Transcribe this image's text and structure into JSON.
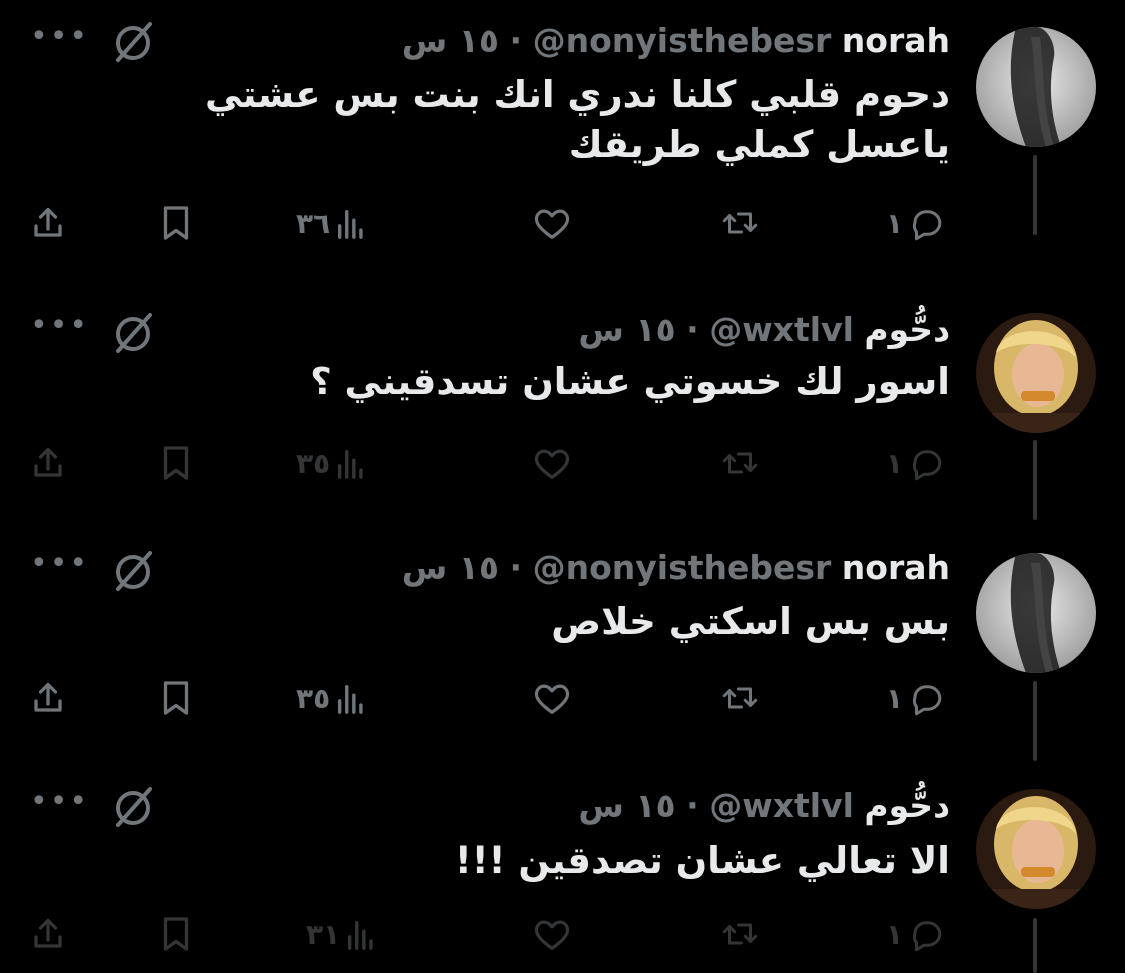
{
  "tweets": [
    {
      "name": "norah",
      "handle": "@nonyisthebesr",
      "dot": "·",
      "time": "١٥ س",
      "text": "دحوم قلبي كلنا ندري انك بنت بس عشتي ياعسل كملي طريقك",
      "replies": "١",
      "views": "٣٦",
      "avatar": "dark-hair"
    },
    {
      "name": "دحُّوم",
      "handle": "@wxtlvl",
      "dot": "·",
      "time": "١٥ س",
      "text": "اسور لك خسوتي عشان تسدقيني ؟",
      "replies": "١",
      "views": "٣٥",
      "avatar": "blonde"
    },
    {
      "name": "norah",
      "handle": "@nonyisthebesr",
      "dot": "·",
      "time": "١٥ س",
      "text": "بس بس اسكتي خلاص",
      "replies": "١",
      "views": "٣٥",
      "avatar": "dark-hair"
    },
    {
      "name": "دحُّوم",
      "handle": "@wxtlvl",
      "dot": "·",
      "time": "١٥ س",
      "text": "الا تعالي عشان تصدقين !!!",
      "replies": "١",
      "views": "٣١",
      "avatar": "blonde"
    }
  ],
  "icons": {
    "more": "more-icon",
    "grok": "grok-icon",
    "reply": "reply-icon",
    "retweet": "retweet-icon",
    "like": "heart-icon",
    "views": "views-chart-icon",
    "bookmark": "bookmark-icon",
    "share": "share-icon"
  },
  "colors": {
    "background": "#000000",
    "text": "#e7e9ea",
    "muted": "#71767b",
    "thread_line": "#333639"
  }
}
